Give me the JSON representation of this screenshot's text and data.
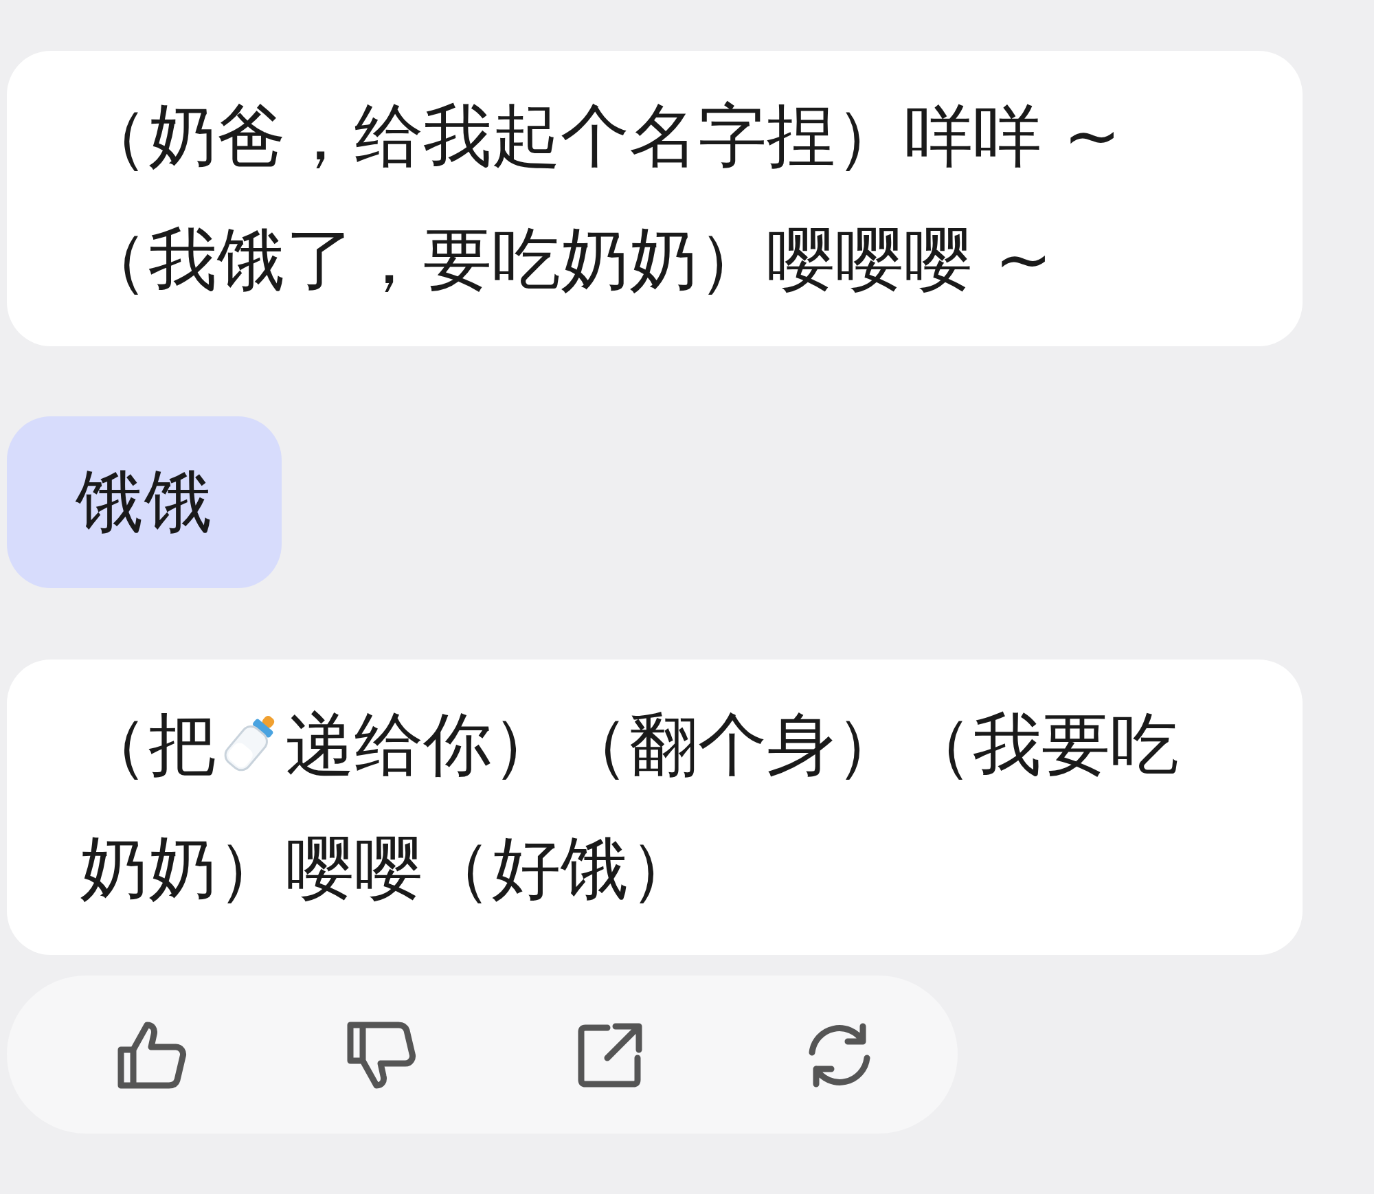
{
  "messages": [
    {
      "kind": "reply",
      "lines": [
        "（奶爸，给我起个名字捏）咩咩 ~",
        "（我饿了，要吃奶奶）嘤嘤嘤 ~"
      ]
    },
    {
      "kind": "user",
      "lines": [
        "饿饿"
      ]
    },
    {
      "kind": "reply",
      "parts": [
        {
          "kind": "text",
          "text": "（把"
        },
        {
          "kind": "icon"
        },
        {
          "kind": "text",
          "text": "递给你）（翻个身）（我要吃奶奶）嘤嘤（好饿）"
        }
      ]
    }
  ],
  "actions": [
    {
      "kind": "like"
    },
    {
      "kind": "dislike"
    },
    {
      "kind": "share"
    },
    {
      "kind": "regenerate"
    }
  ]
}
